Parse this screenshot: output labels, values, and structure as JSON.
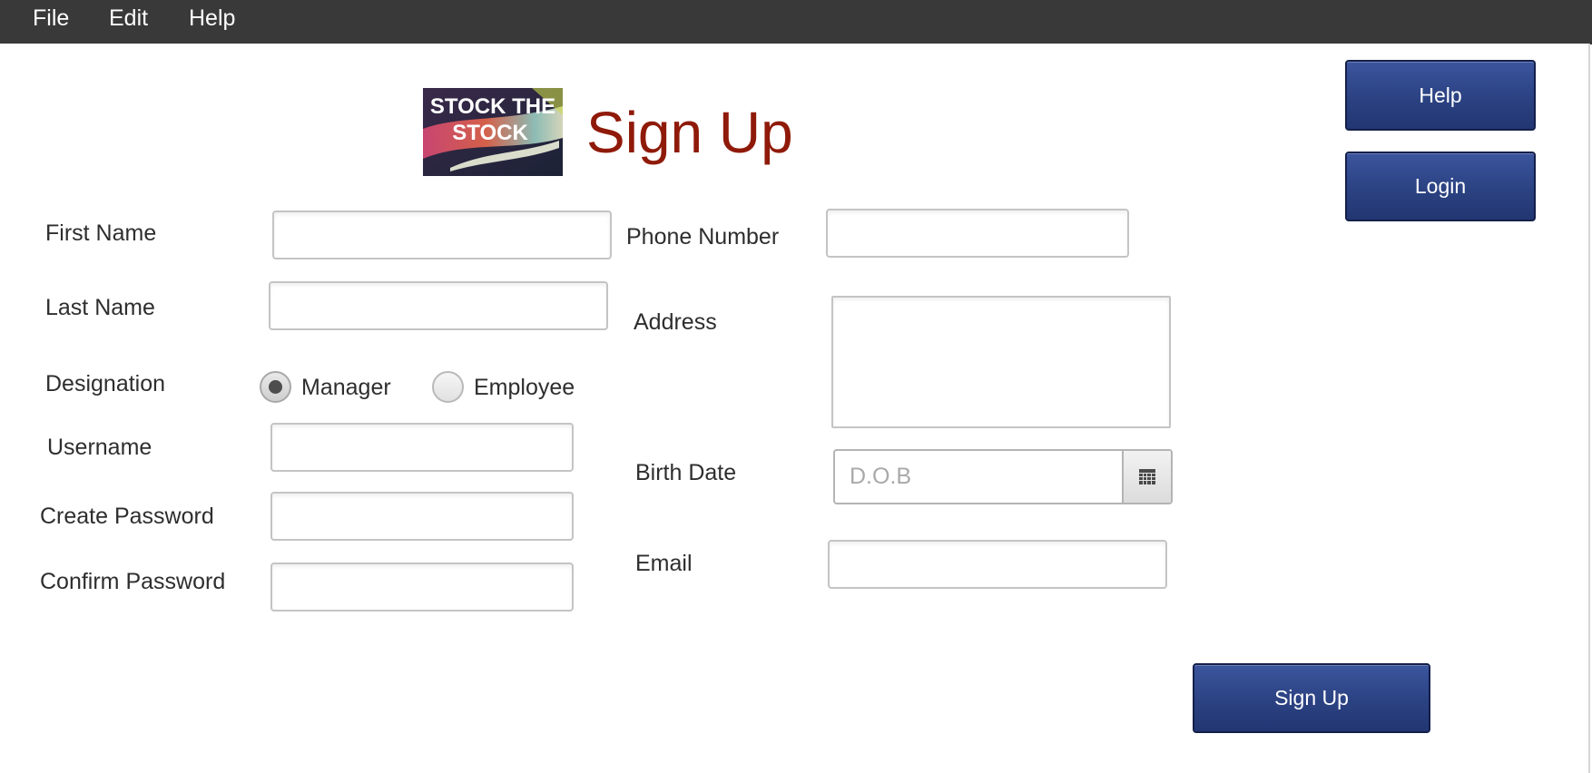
{
  "menubar": {
    "items": [
      "File",
      "Edit",
      "Help"
    ]
  },
  "logo": {
    "line1": "STOCK THE",
    "line2": "STOCK"
  },
  "header": {
    "title": "Sign Up"
  },
  "buttons": {
    "help": "Help",
    "login": "Login",
    "sign_up": "Sign Up"
  },
  "form": {
    "first_name": {
      "label": "First Name",
      "value": ""
    },
    "last_name": {
      "label": "Last Name",
      "value": ""
    },
    "designation": {
      "label": "Designation",
      "options": [
        "Manager",
        "Employee"
      ],
      "selected": "Manager"
    },
    "username": {
      "label": "Username",
      "value": ""
    },
    "create_password": {
      "label": "Create Password",
      "value": ""
    },
    "confirm_password": {
      "label": "Confirm Password",
      "value": ""
    },
    "phone_number": {
      "label": "Phone Number",
      "value": ""
    },
    "address": {
      "label": "Address",
      "value": ""
    },
    "birth_date": {
      "label": "Birth Date",
      "placeholder": "D.O.B",
      "value": ""
    },
    "email": {
      "label": "Email",
      "value": ""
    }
  },
  "icons": {
    "calendar": "calendar-icon"
  },
  "colors": {
    "menubar": "#393939",
    "title": "#8f1a0a",
    "button": "#2b4282"
  }
}
